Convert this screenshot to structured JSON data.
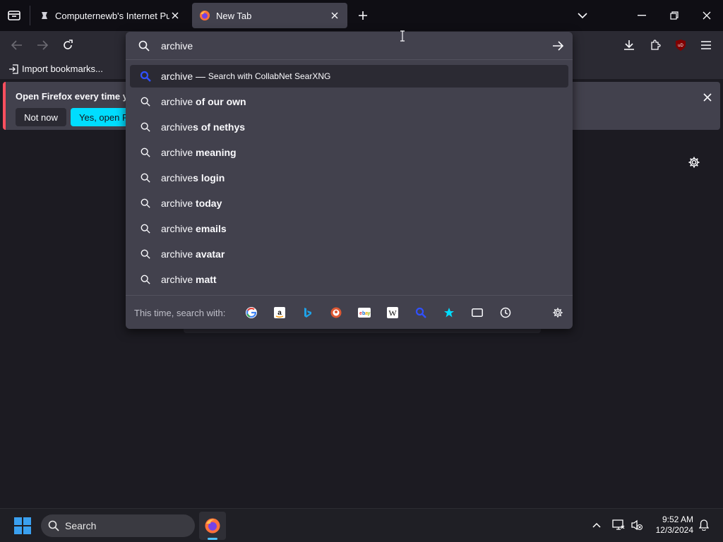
{
  "tabs": [
    {
      "title": "Computernewb's Internet Pub |",
      "active": false
    },
    {
      "title": "New Tab",
      "active": true
    }
  ],
  "bookmarks": {
    "import_label": "Import bookmarks..."
  },
  "notification": {
    "text": "Open Firefox every time you",
    "not_now": "Not now",
    "yes_open": "Yes, open Fire"
  },
  "urlbar": {
    "value": "archive",
    "suggestions": [
      {
        "prefix": "archive",
        "bold": "",
        "suffix": " — ",
        "engine_note": "Search with CollabNet SearXNG",
        "selected": true
      },
      {
        "prefix": "archive",
        "bold": " of our own"
      },
      {
        "prefix": "archive",
        "bold": "s of nethys"
      },
      {
        "prefix": "archive",
        "bold": " meaning"
      },
      {
        "prefix": "archive",
        "bold": "s login"
      },
      {
        "prefix": "archive",
        "bold": " today"
      },
      {
        "prefix": "archive",
        "bold": " emails"
      },
      {
        "prefix": "archive",
        "bold": " avatar"
      },
      {
        "prefix": "archive",
        "bold": " matt"
      }
    ],
    "search_with_label": "This time, search with:",
    "engines": [
      "google-icon",
      "amazon-icon",
      "bing-icon",
      "duckduckgo-icon",
      "ebay-icon",
      "wikipedia-icon",
      "searxng-icon",
      "bookmarks-icon",
      "tabs-icon",
      "history-icon"
    ]
  },
  "taskbar": {
    "search_placeholder": "Search",
    "time": "9:52 AM",
    "date": "12/3/2024"
  },
  "colors": {
    "accent": "#00ddff",
    "searx": "#3050ff"
  }
}
